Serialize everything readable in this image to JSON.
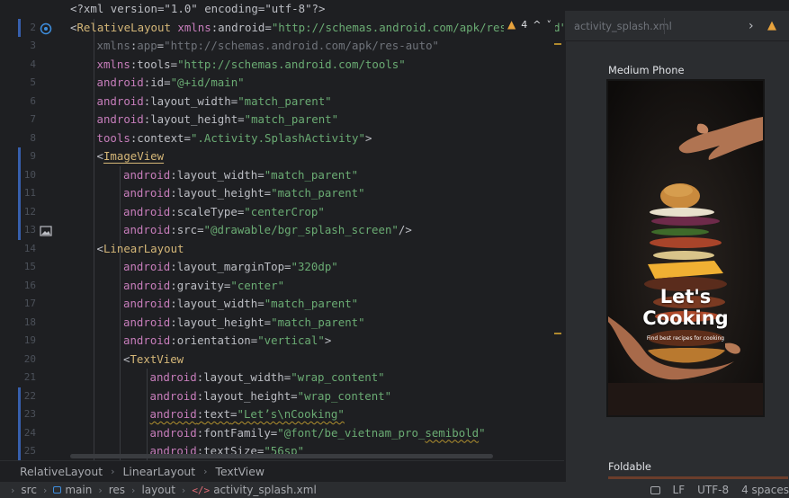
{
  "editor": {
    "inspection": {
      "warning_count": "4",
      "up": "^",
      "down": "˅"
    },
    "lines": [
      {
        "n": "",
        "indent": 1,
        "dim": true,
        "tokens": [
          [
            "t-punc",
            "<?xml version=\"1.0\" encoding=\"utf-8\"?>"
          ]
        ]
      },
      {
        "n": "2",
        "indent": 1,
        "tokens": [
          [
            "t-punc",
            "<"
          ],
          [
            "t-tag",
            "RelativeLayout"
          ],
          [
            "t-punc",
            " "
          ],
          [
            "t-ns",
            "xmlns"
          ],
          [
            "t-punc",
            ":"
          ],
          [
            "t-attr",
            "android"
          ],
          [
            "t-punc",
            "="
          ],
          [
            "t-str",
            "\"http://schemas.android.com/apk/res/android\""
          ]
        ]
      },
      {
        "n": "3",
        "indent": 2,
        "dim": true,
        "tokens": [
          [
            "t-ns",
            "xmlns"
          ],
          [
            "t-punc",
            ":"
          ],
          [
            "t-attr",
            "app"
          ],
          [
            "t-punc",
            "="
          ],
          [
            "t-str",
            "\"http://schemas.android.com/apk/res-auto\""
          ]
        ]
      },
      {
        "n": "4",
        "indent": 2,
        "tokens": [
          [
            "t-ns",
            "xmlns"
          ],
          [
            "t-punc",
            ":"
          ],
          [
            "t-attr",
            "tools"
          ],
          [
            "t-punc",
            "="
          ],
          [
            "t-str",
            "\"http://schemas.android.com/tools\""
          ]
        ]
      },
      {
        "n": "5",
        "indent": 2,
        "tokens": [
          [
            "t-ns",
            "android"
          ],
          [
            "t-punc",
            ":"
          ],
          [
            "t-attr",
            "id"
          ],
          [
            "t-punc",
            "="
          ],
          [
            "t-str",
            "\"@+id/main\""
          ]
        ]
      },
      {
        "n": "6",
        "indent": 2,
        "tokens": [
          [
            "t-ns",
            "android"
          ],
          [
            "t-punc",
            ":"
          ],
          [
            "t-attr",
            "layout_width"
          ],
          [
            "t-punc",
            "="
          ],
          [
            "t-str",
            "\"match_parent\""
          ]
        ]
      },
      {
        "n": "7",
        "indent": 2,
        "tokens": [
          [
            "t-ns",
            "android"
          ],
          [
            "t-punc",
            ":"
          ],
          [
            "t-attr",
            "layout_height"
          ],
          [
            "t-punc",
            "="
          ],
          [
            "t-str",
            "\"match_parent\""
          ]
        ]
      },
      {
        "n": "8",
        "indent": 2,
        "tokens": [
          [
            "t-ns",
            "tools"
          ],
          [
            "t-punc",
            ":"
          ],
          [
            "t-attr",
            "context"
          ],
          [
            "t-punc",
            "="
          ],
          [
            "t-str",
            "\".Activity.SplashActivity\""
          ],
          [
            "t-punc",
            ">"
          ]
        ]
      },
      {
        "n": "9",
        "indent": 2,
        "tokens": [
          [
            "t-punc",
            "<"
          ],
          [
            "t-tag uline",
            "ImageView"
          ]
        ]
      },
      {
        "n": "10",
        "indent": 3,
        "tokens": [
          [
            "t-ns",
            "android"
          ],
          [
            "t-punc",
            ":"
          ],
          [
            "t-attr",
            "layout_width"
          ],
          [
            "t-punc",
            "="
          ],
          [
            "t-str",
            "\"match_parent\""
          ]
        ]
      },
      {
        "n": "11",
        "indent": 3,
        "tokens": [
          [
            "t-ns",
            "android"
          ],
          [
            "t-punc",
            ":"
          ],
          [
            "t-attr",
            "layout_height"
          ],
          [
            "t-punc",
            "="
          ],
          [
            "t-str",
            "\"match_parent\""
          ]
        ]
      },
      {
        "n": "12",
        "indent": 3,
        "tokens": [
          [
            "t-ns",
            "android"
          ],
          [
            "t-punc",
            ":"
          ],
          [
            "t-attr",
            "scaleType"
          ],
          [
            "t-punc",
            "="
          ],
          [
            "t-str",
            "\"centerCrop\""
          ]
        ]
      },
      {
        "n": "13",
        "indent": 3,
        "icon": true,
        "tokens": [
          [
            "t-ns",
            "android"
          ],
          [
            "t-punc",
            ":"
          ],
          [
            "t-attr",
            "src"
          ],
          [
            "t-punc",
            "="
          ],
          [
            "t-str",
            "\"@drawable/bgr_splash_screen\""
          ],
          [
            "t-punc",
            "/>"
          ]
        ]
      },
      {
        "n": "14",
        "indent": 2,
        "tokens": [
          [
            "t-punc",
            "<"
          ],
          [
            "t-tag",
            "LinearLayout"
          ]
        ]
      },
      {
        "n": "15",
        "indent": 3,
        "tokens": [
          [
            "t-ns",
            "android"
          ],
          [
            "t-punc",
            ":"
          ],
          [
            "t-attr",
            "layout_marginTop"
          ],
          [
            "t-punc",
            "="
          ],
          [
            "t-str",
            "\"320dp\""
          ]
        ]
      },
      {
        "n": "16",
        "indent": 3,
        "tokens": [
          [
            "t-ns",
            "android"
          ],
          [
            "t-punc",
            ":"
          ],
          [
            "t-attr",
            "gravity"
          ],
          [
            "t-punc",
            "="
          ],
          [
            "t-str",
            "\"center\""
          ]
        ]
      },
      {
        "n": "17",
        "indent": 3,
        "tokens": [
          [
            "t-ns",
            "android"
          ],
          [
            "t-punc",
            ":"
          ],
          [
            "t-attr",
            "layout_width"
          ],
          [
            "t-punc",
            "="
          ],
          [
            "t-str",
            "\"match_parent\""
          ]
        ]
      },
      {
        "n": "18",
        "indent": 3,
        "tokens": [
          [
            "t-ns",
            "android"
          ],
          [
            "t-punc",
            ":"
          ],
          [
            "t-attr",
            "layout_height"
          ],
          [
            "t-punc",
            "="
          ],
          [
            "t-str",
            "\"match_parent\""
          ]
        ]
      },
      {
        "n": "19",
        "indent": 3,
        "tokens": [
          [
            "t-ns",
            "android"
          ],
          [
            "t-punc",
            ":"
          ],
          [
            "t-attr",
            "orientation"
          ],
          [
            "t-punc",
            "="
          ],
          [
            "t-str",
            "\"vertical\""
          ],
          [
            "t-punc",
            ">"
          ]
        ]
      },
      {
        "n": "20",
        "indent": 3,
        "tokens": [
          [
            "t-punc",
            "<"
          ],
          [
            "t-tag",
            "TextView"
          ]
        ]
      },
      {
        "n": "21",
        "indent": 4,
        "tokens": [
          [
            "t-ns",
            "android"
          ],
          [
            "t-punc",
            ":"
          ],
          [
            "t-attr",
            "layout_width"
          ],
          [
            "t-punc",
            "="
          ],
          [
            "t-str",
            "\"wrap_content\""
          ]
        ]
      },
      {
        "n": "22",
        "indent": 4,
        "tokens": [
          [
            "t-ns",
            "android"
          ],
          [
            "t-punc",
            ":"
          ],
          [
            "t-attr",
            "layout_height"
          ],
          [
            "t-punc",
            "="
          ],
          [
            "t-str",
            "\"wrap_content\""
          ]
        ]
      },
      {
        "n": "23",
        "indent": 4,
        "tokens": [
          [
            "t-ns squig",
            "android"
          ],
          [
            "t-punc squig",
            ":"
          ],
          [
            "t-attr squig",
            "text"
          ],
          [
            "t-punc squig",
            "="
          ],
          [
            "t-str squig",
            "\"Let’s\\nCooking\""
          ]
        ]
      },
      {
        "n": "24",
        "indent": 4,
        "tokens": [
          [
            "t-ns",
            "android"
          ],
          [
            "t-punc",
            ":"
          ],
          [
            "t-attr",
            "fontFamily"
          ],
          [
            "t-punc",
            "="
          ],
          [
            "t-str",
            "\"@font/be_vietnam_pro_"
          ],
          [
            "t-str squig",
            "semibold"
          ],
          [
            "t-str",
            "\""
          ]
        ]
      },
      {
        "n": "25",
        "indent": 4,
        "tokens": [
          [
            "t-ns",
            "android"
          ],
          [
            "t-punc",
            ":"
          ],
          [
            "t-attr",
            "textSize"
          ],
          [
            "t-punc",
            "="
          ],
          [
            "t-str",
            "\"56sp\""
          ]
        ]
      }
    ]
  },
  "breadcrumb": [
    "RelativeLayout",
    "LinearLayout",
    "TextView"
  ],
  "preview": {
    "tab_title": "activity_splash.xml",
    "chevron": "›",
    "warning": "▲",
    "device_label": "Medium Phone",
    "splash_title": "Let's\nCooking",
    "splash_subtitle": "Find best recipes for cooking",
    "foldable_label": "Foldable"
  },
  "statusbar": {
    "path": [
      "src",
      "main",
      "res",
      "layout",
      "activity_splash.xml"
    ],
    "line_ending": "LF",
    "encoding": "UTF-8",
    "indent": "4 spaces"
  },
  "colors": {
    "accent": "#375fad",
    "warning": "#e8a33d",
    "string": "#6aab73",
    "tag": "#d5b778",
    "namespace": "#c77dbb"
  },
  "icons": {
    "gutter_line2": "bean-icon",
    "gutter_line13": "image-icon",
    "statusbar_module": "module-icon",
    "statusbar_file": "xml-file-icon"
  }
}
